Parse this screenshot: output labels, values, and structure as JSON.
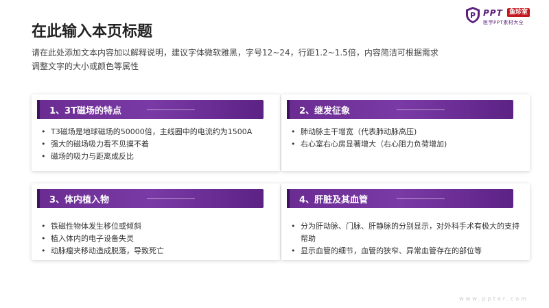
{
  "logo": {
    "brand": "PPT",
    "tag": "鱼珍室",
    "subtitle": "医学PPT素材大全",
    "icon": "shield-p-icon"
  },
  "title": "在此输入本页标题",
  "description": "请在此处添加文本内容加以解释说明，建议字体微软雅黑，字号12~24，行距1.2~1.5倍，内容简洁可根据需求调整文字的大小或颜色等属性",
  "colors": {
    "accent": "#6a2c91",
    "accent_dark": "#3f1260"
  },
  "cards": [
    {
      "heading": "1、3T磁场的特点",
      "items": [
        "T3磁场是地球磁场的50000倍，主线圈中的电流约为1500A",
        "强大的磁场吸力看不见摸不着",
        "磁场的吸力与距离成反比"
      ]
    },
    {
      "heading": "2、继发征象",
      "items": [
        "肺动脉主干增宽（代表肺动脉高压)",
        "右心室右心房显著增大（右心阻力负荷增加)"
      ]
    },
    {
      "heading": "3、体内植入物",
      "items": [
        "铁磁性物体发生移位或倾斜",
        "植入体内的电子设备失灵",
        "动脉瘤夹移动造成脱落，导致死亡"
      ]
    },
    {
      "heading": "4、肝脏及其血管",
      "items": [
        "分为肝动脉、门脉、肝静脉的分别显示，对外科手术有极大的支持帮助",
        "显示血管的细节，血管的狭窄、异常血管存在的部位等"
      ]
    }
  ],
  "footer": "www.ppter.com"
}
